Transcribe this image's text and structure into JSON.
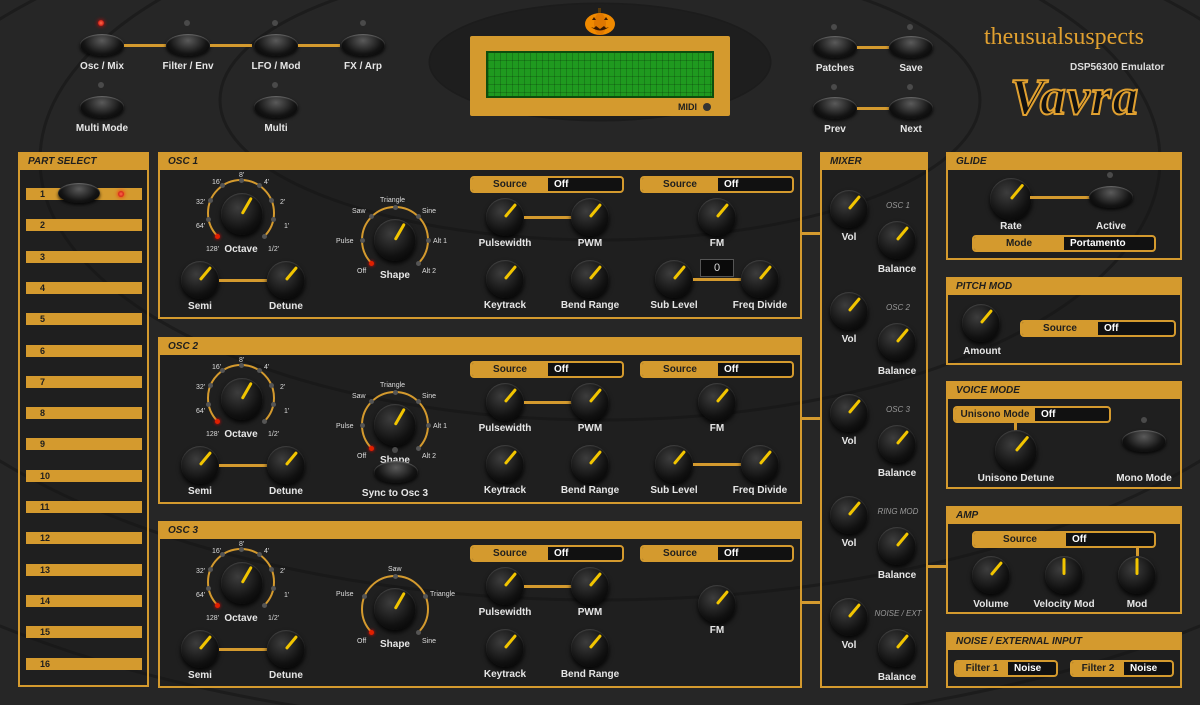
{
  "header": {
    "buttons": [
      {
        "label": "Osc / Mix",
        "active": true
      },
      {
        "label": "Filter / Env"
      },
      {
        "label": "LFO / Mod"
      },
      {
        "label": "FX / Arp"
      },
      {
        "label": "Multi Mode"
      },
      {
        "label": "Multi"
      },
      {
        "label": "Patches"
      },
      {
        "label": "Save"
      },
      {
        "label": "Prev"
      },
      {
        "label": "Next"
      }
    ],
    "midi_label": "MIDI",
    "brand": "theusualsuspects",
    "subtitle": "DSP56300 Emulator",
    "product": "Vavra"
  },
  "part_select": {
    "title": "PART SELECT",
    "parts": [
      "1",
      "2",
      "3",
      "4",
      "5",
      "6",
      "7",
      "8",
      "9",
      "10",
      "11",
      "12",
      "13",
      "14",
      "15",
      "16"
    ],
    "selected": "1"
  },
  "osc_ticks": {
    "t16": "16'",
    "t8": "8'",
    "t4": "4'",
    "t32": "32'",
    "t2": "2'",
    "t64": "64'",
    "t1": "1'",
    "t128": "128'",
    "thalf": "1/2'"
  },
  "osc1": {
    "title": "OSC 1",
    "octave": "Octave",
    "semi": "Semi",
    "detune": "Detune",
    "shape": "Shape",
    "shapes": {
      "saw": "Saw",
      "triangle": "Triangle",
      "sine": "Sine",
      "pulse": "Pulse",
      "alt1": "Alt 1",
      "off": "Off",
      "alt2": "Alt 2"
    },
    "source_label": "Source",
    "source1": "Off",
    "source2": "Off",
    "pulsewidth": "Pulsewidth",
    "pwm": "PWM",
    "fm": "FM",
    "keytrack": "Keytrack",
    "bend_range": "Bend Range",
    "sub_level": "Sub Level",
    "freq_divide": "Freq Divide",
    "freq_value": "0"
  },
  "osc2": {
    "title": "OSC 2",
    "octave": "Octave",
    "semi": "Semi",
    "detune": "Detune",
    "shape": "Shape",
    "shapes": {
      "saw": "Saw",
      "triangle": "Triangle",
      "sine": "Sine",
      "pulse": "Pulse",
      "alt1": "Alt 1",
      "off": "Off",
      "alt2": "Alt 2"
    },
    "source_label": "Source",
    "source1": "Off",
    "source2": "Off",
    "pulsewidth": "Pulsewidth",
    "pwm": "PWM",
    "fm": "FM",
    "sync": "Sync to Osc 3",
    "keytrack": "Keytrack",
    "bend_range": "Bend Range",
    "sub_level": "Sub Level",
    "freq_divide": "Freq Divide"
  },
  "osc3": {
    "title": "OSC 3",
    "octave": "Octave",
    "semi": "Semi",
    "detune": "Detune",
    "shape": "Shape",
    "shapes": {
      "saw": "Saw",
      "triangle": "Triangle",
      "pulse": "Pulse",
      "off": "Off",
      "sine": "Sine"
    },
    "source_label": "Source",
    "source1": "Off",
    "source2": "Off",
    "pulsewidth": "Pulsewidth",
    "pwm": "PWM",
    "fm": "FM",
    "keytrack": "Keytrack",
    "bend_range": "Bend Range"
  },
  "mixer": {
    "title": "MIXER",
    "vol": "Vol",
    "balance": "Balance",
    "channels": [
      "OSC 1",
      "OSC 2",
      "OSC 3",
      "RING MOD",
      "NOISE / EXT"
    ]
  },
  "glide": {
    "title": "GLIDE",
    "rate": "Rate",
    "active": "Active",
    "mode_label": "Mode",
    "mode_value": "Portamento"
  },
  "pitch_mod": {
    "title": "PITCH MOD",
    "amount": "Amount",
    "source_label": "Source",
    "source_value": "Off"
  },
  "voice_mode": {
    "title": "VOICE MODE",
    "unisono_label": "Unisono Mode",
    "unisono_value": "Off",
    "unisono_detune": "Unisono Detune",
    "mono_mode": "Mono Mode"
  },
  "amp": {
    "title": "AMP",
    "source_label": "Source",
    "source_value": "Off",
    "volume": "Volume",
    "velocity_mod": "Velocity Mod",
    "mod": "Mod"
  },
  "noise": {
    "title": "NOISE / EXTERNAL INPUT",
    "filter1_label": "Filter 1",
    "filter1_value": "Noise",
    "filter2_label": "Filter 2",
    "filter2_value": "Noise"
  },
  "colors": {
    "accent": "#d49a2e",
    "bg": "#262626",
    "lcd": "#1f9a1f",
    "knob_pointer": "#f2c500"
  }
}
